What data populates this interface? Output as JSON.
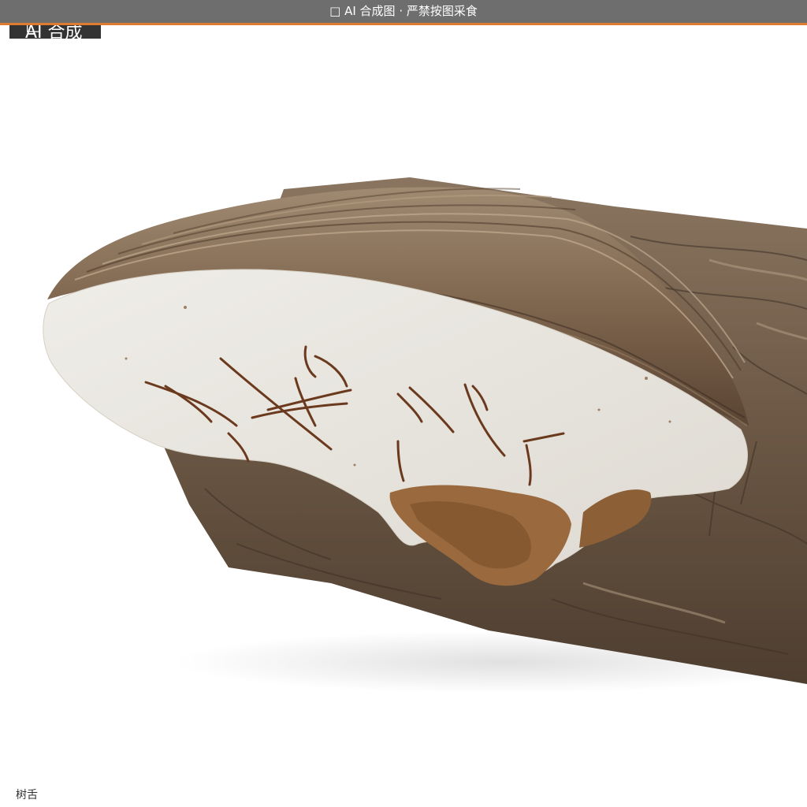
{
  "banner": {
    "glyph": "□",
    "text": "AI 合成图 · 严禁按图采食"
  },
  "badge": {
    "glyph": "□",
    "text": "AI 合成"
  },
  "caption": "树舌",
  "colors": {
    "banner_bg": "#6e6e6e",
    "banner_rule": "#e07a2f",
    "badge_bg": "#333333",
    "fungus_pore_surface": "#ebe8e2",
    "fungus_cap": "#8a6e54",
    "log_bark": "#6b5744"
  }
}
